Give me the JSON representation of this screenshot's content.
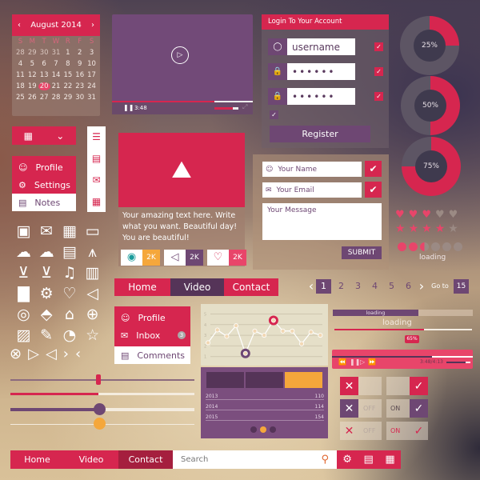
{
  "calendar": {
    "month": "August 2014",
    "weekdays": [
      "S",
      "M",
      "T",
      "W",
      "R",
      "F",
      "S"
    ],
    "days": [
      "28",
      "29",
      "30",
      "31",
      "1",
      "2",
      "3",
      "4",
      "5",
      "6",
      "7",
      "8",
      "9",
      "10",
      "11",
      "12",
      "13",
      "14",
      "15",
      "16",
      "17",
      "18",
      "19",
      "20",
      "21",
      "22",
      "23",
      "24",
      "25",
      "26",
      "27",
      "28",
      "29",
      "30",
      "31"
    ],
    "selected": "20",
    "prev_icon": "chevron-left-icon",
    "next_icon": "chevron-right-icon"
  },
  "video": {
    "time": "3:48",
    "progress": 0.73,
    "volume": 0.75
  },
  "login": {
    "title": "Login To Your Account",
    "username": "username",
    "password": "••••••",
    "confirm": "••••••",
    "register": "Register"
  },
  "donuts": [
    {
      "label": "25%",
      "value": 25
    },
    {
      "label": "50%",
      "value": 50
    },
    {
      "label": "75%",
      "value": 75
    }
  ],
  "dropdown_menu": {
    "items": [
      {
        "label": "Profile",
        "icon": "user-icon"
      },
      {
        "label": "Settings",
        "icon": "gear-icon"
      },
      {
        "label": "Notes",
        "icon": "note-icon"
      }
    ]
  },
  "card": {
    "text": "Your amazing text here. Write what you want. Beautiful day! You are beautiful!",
    "badges": [
      {
        "icon": "eye-icon",
        "count": "2K",
        "color": "#f5a73b"
      },
      {
        "icon": "megaphone-icon",
        "count": "2K",
        "color": "#6e4773"
      },
      {
        "icon": "heart-icon",
        "count": "2K",
        "color": "#e8456a"
      }
    ]
  },
  "contact": {
    "name_placeholder": "Your Name",
    "email_placeholder": "Your Email",
    "message_placeholder": "Your Message",
    "submit": "SUBMIT"
  },
  "rating": {
    "hearts": 3,
    "stars": 4,
    "max": 5,
    "loading_label": "loading",
    "loading_dots": 2.5
  },
  "tabs": {
    "items": [
      "Home",
      "Video",
      "Contact"
    ],
    "active": "Video"
  },
  "submenu": {
    "items": [
      {
        "label": "Profile"
      },
      {
        "label": "Inbox",
        "badge": "3"
      },
      {
        "label": "Comments"
      }
    ]
  },
  "pagination": {
    "pages": [
      "1",
      "2",
      "3",
      "4",
      "5",
      "6"
    ],
    "current": "1",
    "goto_label": "Go to",
    "goto_value": "15"
  },
  "line_chart": {
    "y_ticks": [
      "1",
      "2",
      "3",
      "4",
      "5"
    ],
    "values": [
      2.3,
      3.5,
      2.9,
      3.9,
      1.3,
      3.4,
      3.0,
      4.4,
      3.4,
      3.4,
      2.2,
      3.3,
      3.0
    ],
    "highlight_max": 4.4,
    "highlight_min": 1.3
  },
  "data_table": {
    "rows": [
      {
        "year": "2013",
        "value": "110"
      },
      {
        "year": "2014",
        "value": "114"
      },
      {
        "year": "2015",
        "value": "154"
      }
    ]
  },
  "progress": {
    "bar_label": "loading",
    "bar_value": 0.61,
    "line_label": "loading",
    "line_value": 65,
    "line_value_label": "65%"
  },
  "media": {
    "time": "3:48/4:13",
    "progress": 0.71
  },
  "toggles": [
    {
      "left": "x-on",
      "right": "check-on"
    },
    {
      "left_label": "OFF",
      "right_label": "ON"
    },
    {
      "left_label": "OFF",
      "right_label": "ON"
    }
  ],
  "sliders": [
    0.48,
    0.48,
    0.48,
    0.48
  ],
  "bottom_nav": {
    "items": [
      "Home",
      "Video",
      "Contact"
    ],
    "active": "Contact",
    "search_placeholder": "Search"
  },
  "colors": {
    "red": "#d6264f",
    "purple": "#6e4773",
    "orange": "#f5a73b"
  }
}
